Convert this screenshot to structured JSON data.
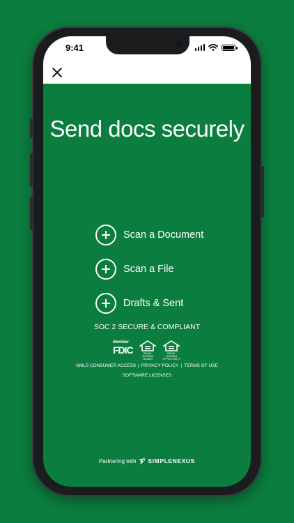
{
  "status": {
    "time": "9:41"
  },
  "title": "Send docs securely",
  "actions": [
    {
      "label": "Scan a Document"
    },
    {
      "label": "Scan a File"
    },
    {
      "label": "Drafts & Sent"
    }
  ],
  "compliance": "SOC 2 SECURE & COMPLIANT",
  "badges": {
    "fdic_member": "Member",
    "fdic": "FDIC",
    "ehl": "EQUAL HOUSING LENDER",
    "eho": "EQUAL HOUSING OPPORTUNITY"
  },
  "footer_links": [
    "NMLS CONSUMER ACCESS",
    "PRIVACY POLICY",
    "TERMS OF USE"
  ],
  "footer_separator": "|",
  "software_licenses": "SOFTWARE LICENSES",
  "partner": {
    "text": "Partnering with",
    "brand": "SIMPLENEXUS"
  },
  "colors": {
    "brand_green": "#0b7d3e",
    "white": "#ffffff"
  },
  "icons": [
    "close-icon",
    "plus-circle-icon",
    "signal-icon",
    "wifi-icon",
    "battery-icon",
    "equal-housing-icon",
    "simplenexus-logo-icon"
  ]
}
